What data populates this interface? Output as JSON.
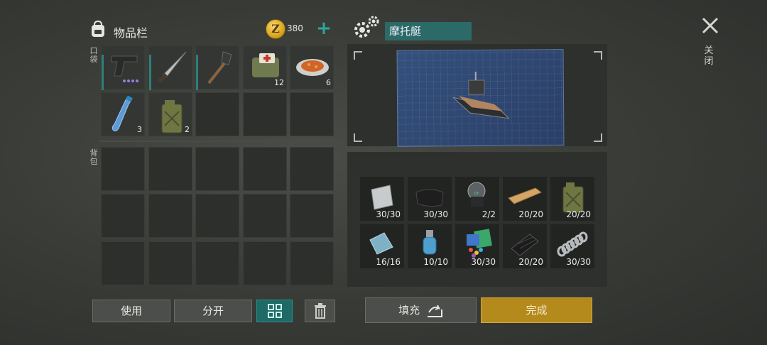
{
  "inventory": {
    "title": "物品栏",
    "coins": "380",
    "pocket_label": "口袋",
    "backpack_label": "背包",
    "pocket_slots": [
      {
        "item": "pistol-icon",
        "qty": ""
      },
      {
        "item": "machete-icon",
        "qty": ""
      },
      {
        "item": "shovel-icon",
        "qty": ""
      },
      {
        "item": "medkit-bag-icon",
        "qty": "12"
      },
      {
        "item": "food-plate-icon",
        "qty": "6"
      },
      {
        "item": "water-bottle-icon",
        "qty": "3"
      },
      {
        "item": "jerrycan-icon",
        "qty": "2"
      }
    ]
  },
  "craft": {
    "name": "摩托艇",
    "close_label": "关闭",
    "materials": [
      {
        "item": "metal-sheet-icon",
        "count": "30/30"
      },
      {
        "item": "cloth-icon",
        "count": "30/30"
      },
      {
        "item": "helmet-engine-icon",
        "count": "2/2"
      },
      {
        "item": "planks-icon",
        "count": "20/20"
      },
      {
        "item": "jerrycan-icon",
        "count": "20/20"
      },
      {
        "item": "glass-plate-icon",
        "count": "16/16"
      },
      {
        "item": "water-pump-icon",
        "count": "10/10"
      },
      {
        "item": "circuit-parts-icon",
        "count": "30/30"
      },
      {
        "item": "rubber-hose-icon",
        "count": "20/20"
      },
      {
        "item": "spring-icon",
        "count": "30/30"
      }
    ]
  },
  "buttons": {
    "use": "使用",
    "split": "分开",
    "fill": "填充",
    "complete": "完成"
  },
  "colors": {
    "accent_teal": "#2aa79b",
    "gold": "#b48a1c"
  }
}
